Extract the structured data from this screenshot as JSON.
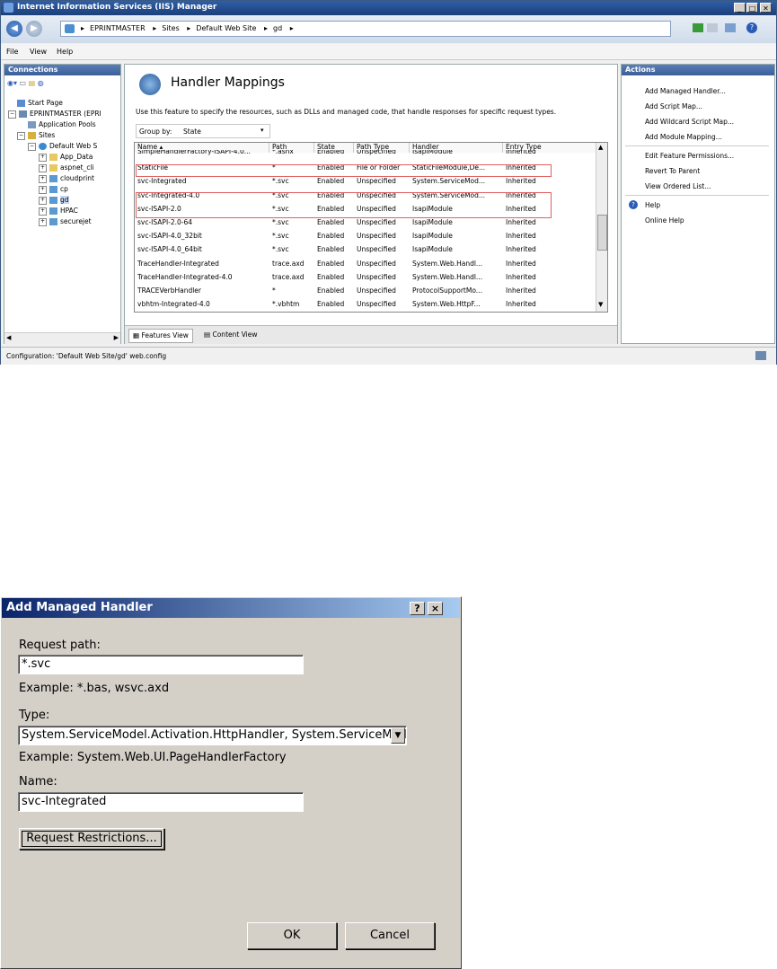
{
  "iis": {
    "title": "Internet Information Services (IIS) Manager",
    "breadcrumb": [
      "EPRINTMASTER",
      "Sites",
      "Default Web Site",
      "gd"
    ],
    "menu": [
      "File",
      "View",
      "Help"
    ],
    "connections": {
      "header": "Connections",
      "tree": [
        "Start Page",
        "EPRINTMASTER (EPRI",
        "Application Pools",
        "Sites",
        "Default Web S",
        "App_Data",
        "aspnet_cli",
        "cloudprint",
        "cp",
        "gd",
        "HPAC",
        "securejet"
      ]
    },
    "feature": {
      "title": "Handler Mappings",
      "description": "Use this feature to specify the resources, such as DLLs and managed code, that handle responses for specific request types.",
      "group_by_label": "Group by:",
      "group_by_value": "State",
      "columns": [
        "Name",
        "Path",
        "State",
        "Path Type",
        "Handler",
        "Entry Type"
      ],
      "rows": [
        [
          "SimpleHandlerFactory-ISAPI-4.0...",
          "*.ashx",
          "Enabled",
          "Unspecified",
          "IsapiModule",
          "Inherited"
        ],
        [
          "StaticFile",
          "*",
          "Enabled",
          "File or Folder",
          "StaticFileModule,De...",
          "Inherited"
        ],
        [
          "svc-Integrated",
          "*.svc",
          "Enabled",
          "Unspecified",
          "System.ServiceMod...",
          "Inherited"
        ],
        [
          "svc-Integrated-4.0",
          "*.svc",
          "Enabled",
          "Unspecified",
          "System.ServiceMod...",
          "Inherited"
        ],
        [
          "svc-ISAPI-2.0",
          "*.svc",
          "Enabled",
          "Unspecified",
          "IsapiModule",
          "Inherited"
        ],
        [
          "svc-ISAPI-2.0-64",
          "*.svc",
          "Enabled",
          "Unspecified",
          "IsapiModule",
          "Inherited"
        ],
        [
          "svc-ISAPI-4.0_32bit",
          "*.svc",
          "Enabled",
          "Unspecified",
          "IsapiModule",
          "Inherited"
        ],
        [
          "svc-ISAPI-4.0_64bit",
          "*.svc",
          "Enabled",
          "Unspecified",
          "IsapiModule",
          "Inherited"
        ],
        [
          "TraceHandler-Integrated",
          "trace.axd",
          "Enabled",
          "Unspecified",
          "System.Web.Handl...",
          "Inherited"
        ],
        [
          "TraceHandler-Integrated-4.0",
          "trace.axd",
          "Enabled",
          "Unspecified",
          "System.Web.Handl...",
          "Inherited"
        ],
        [
          "TRACEVerbHandler",
          "*",
          "Enabled",
          "Unspecified",
          "ProtocolSupportMo...",
          "Inherited"
        ],
        [
          "vbhtm-Integrated-4.0",
          "*.vbhtm",
          "Enabled",
          "Unspecified",
          "System.Web.HttpF...",
          "Inherited"
        ]
      ],
      "tab_features": "Features View",
      "tab_content": "Content View"
    },
    "actions": {
      "header": "Actions",
      "items": [
        "Add Managed Handler...",
        "Add Script Map...",
        "Add Wildcard Script Map...",
        "Add Module Mapping...",
        "Edit Feature Permissions...",
        "Revert To Parent",
        "View Ordered List...",
        "Help",
        "Online Help"
      ]
    },
    "status": "Configuration: 'Default Web Site/gd' web.config"
  },
  "dialog": {
    "title": "Add Managed Handler",
    "request_path_label": "Request path:",
    "request_path_value": "*.svc",
    "request_path_example": "Example: *.bas, wsvc.axd",
    "type_label": "Type:",
    "type_value": "System.ServiceModel.Activation.HttpHandler, System.ServiceModel",
    "type_example": "Example: System.Web.UI.PageHandlerFactory",
    "name_label": "Name:",
    "name_value": "svc-Integrated",
    "restrictions_button": "Request Restrictions...",
    "ok": "OK",
    "cancel": "Cancel",
    "help_btn": "?",
    "close_btn": "×"
  },
  "colors": {
    "highlight_border": "#e06060",
    "titlebar": "#1c3f78",
    "dialog_title": "#0a246a"
  }
}
